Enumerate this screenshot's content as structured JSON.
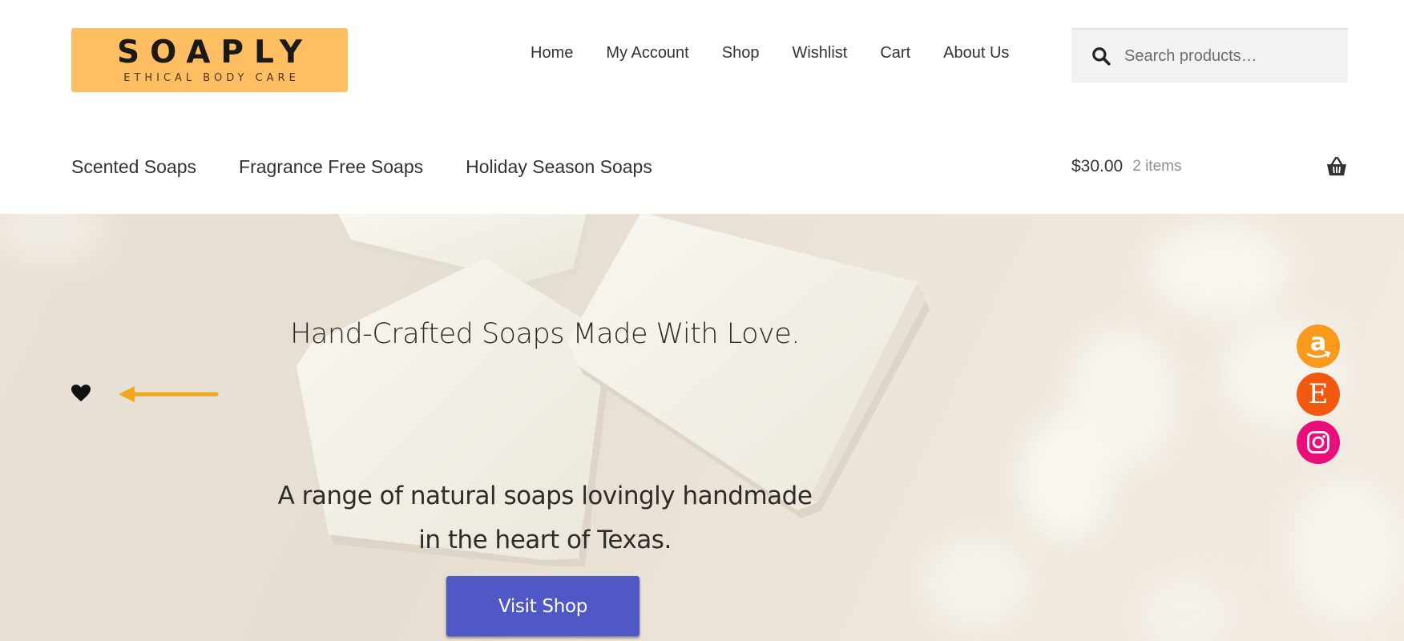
{
  "brand": {
    "name": "SOAPLY",
    "tagline": "ETHICAL BODY CARE",
    "logo_color": "#ffbe62"
  },
  "main_nav": {
    "items": [
      {
        "label": "Home"
      },
      {
        "label": "My Account"
      },
      {
        "label": "Shop"
      },
      {
        "label": "Wishlist"
      },
      {
        "label": "Cart"
      },
      {
        "label": "About Us"
      }
    ]
  },
  "search": {
    "placeholder": "Search products…",
    "icon": "search-icon"
  },
  "category_nav": {
    "items": [
      {
        "label": "Scented Soaps"
      },
      {
        "label": "Fragrance Free Soaps"
      },
      {
        "label": "Holiday Season Soaps"
      }
    ]
  },
  "cart": {
    "amount": "$30.00",
    "count": "2 items",
    "icon": "basket-icon"
  },
  "hero": {
    "title": "Hand-Crafted Soaps Made With Love.",
    "subtitle_line1": "A range of natural soaps lovingly handmade",
    "subtitle_line2": "in the heart of Texas.",
    "button_label": "Visit Shop",
    "button_color": "#5058c6",
    "wishlist_icon": "heart-icon",
    "arrow_color": "#f2a81d"
  },
  "social": {
    "amazon": {
      "glyph": "a",
      "color": "#f99a1c"
    },
    "etsy": {
      "glyph": "E",
      "color": "#f0590f"
    },
    "instagram": {
      "color": "#ea0d7a"
    }
  }
}
